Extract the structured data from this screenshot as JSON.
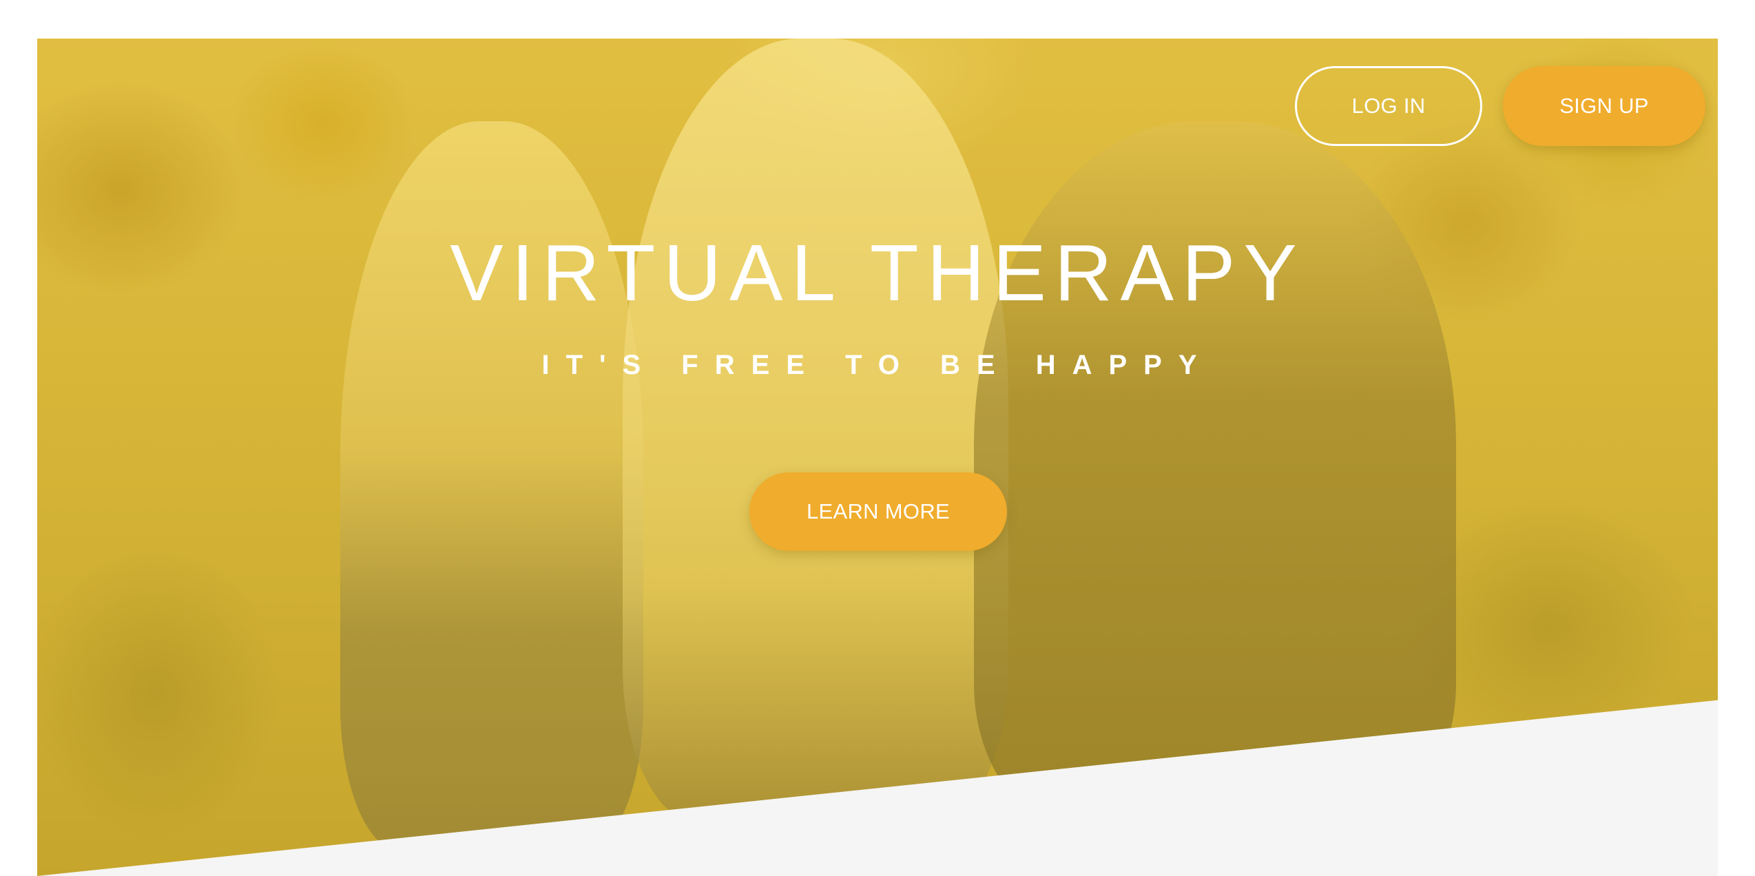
{
  "nav": {
    "login_label": "LOG IN",
    "signup_label": "SIGN UP"
  },
  "hero": {
    "title": "VIRTUAL THERAPY",
    "subtitle": "IT'S FREE TO BE HAPPY",
    "cta_label": "LEARN MORE"
  },
  "colors": {
    "accent": "#f0ac2c",
    "overlay": "#e7c441",
    "text": "#ffffff",
    "page_background": "#f5f5f5"
  }
}
